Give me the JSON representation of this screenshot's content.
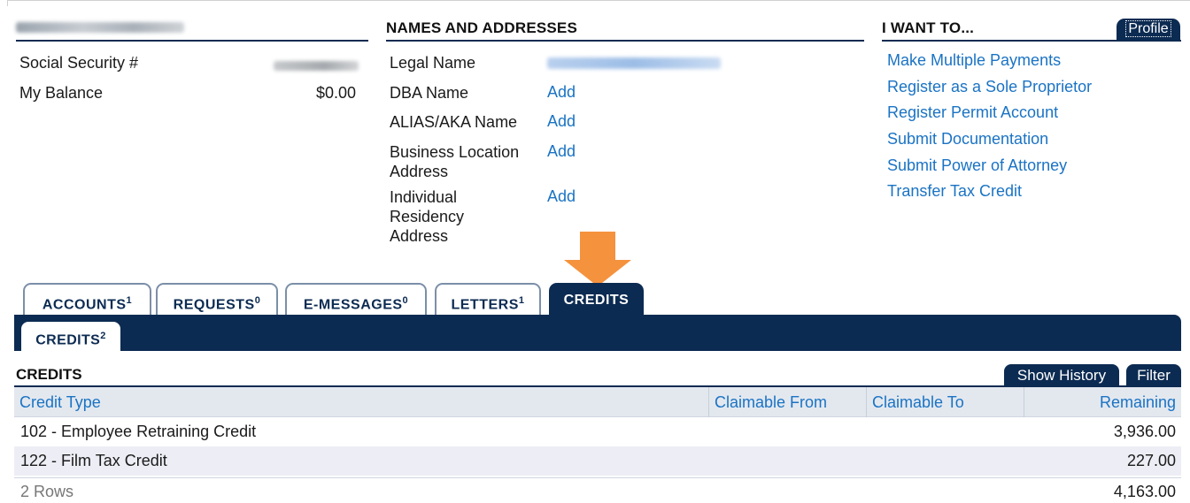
{
  "profile": {
    "name": "THOMAS CAPPELLO",
    "ssn_label": "Social Security #",
    "ssn_value": "XXX-XX-4837",
    "balance_label": "My Balance",
    "balance_value": "$0.00"
  },
  "names": {
    "title": "NAMES AND ADDRESSES",
    "legal_label": "Legal Name",
    "legal_value": "THOMAS CAPPELLO",
    "dba_label": "DBA Name",
    "alias_label": "ALIAS/AKA Name",
    "bla_label": "Business Location Address",
    "ira_label": "Individual Residency Address",
    "add": "Add"
  },
  "want": {
    "title": "I WANT TO...",
    "profile_btn": "Profile",
    "links": [
      "Make Multiple Payments",
      "Register as a Sole Proprietor",
      "Register Permit Account",
      "Submit Documentation",
      "Submit Power of Attorney",
      "Transfer Tax Credit"
    ]
  },
  "tabs": [
    {
      "label": "ACCOUNTS",
      "count": "1"
    },
    {
      "label": "REQUESTS",
      "count": "0"
    },
    {
      "label": "E-MESSAGES",
      "count": "0"
    },
    {
      "label": "LETTERS",
      "count": "1"
    },
    {
      "label": "CREDITS",
      "count": ""
    }
  ],
  "subtab": {
    "label": "CREDITS",
    "count": "2"
  },
  "credits": {
    "title": "CREDITS",
    "show_history": "Show History",
    "filter": "Filter",
    "columns": [
      "Credit Type",
      "Claimable From",
      "Claimable To",
      "Remaining"
    ],
    "rows": [
      {
        "type": "102 - Employee Retraining Credit",
        "from": "",
        "to": "",
        "remaining": "3,936.00"
      },
      {
        "type": "122 - Film Tax Credit",
        "from": "",
        "to": "",
        "remaining": "227.00"
      }
    ],
    "footer_rows": "2 Rows",
    "footer_total": "4,163.00"
  },
  "colors": {
    "navy": "#0c2b52",
    "link": "#1a73c4",
    "arrow": "#f5923e"
  }
}
